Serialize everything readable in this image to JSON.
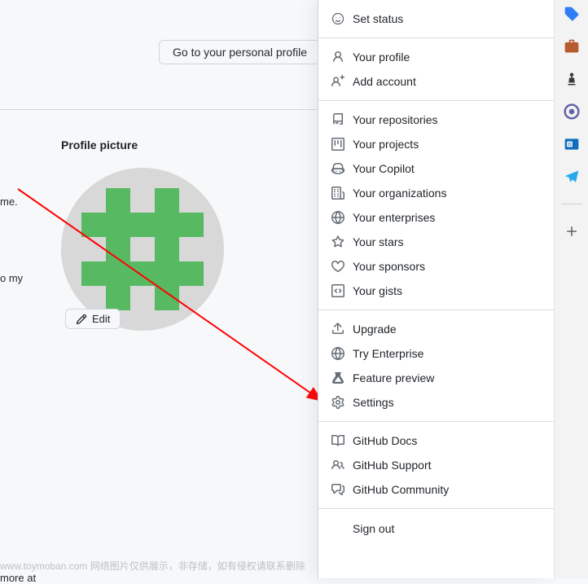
{
  "header": {
    "profile_button": "Go to your personal profile"
  },
  "profile": {
    "title": "Profile picture",
    "edit_label": "Edit"
  },
  "left_text": {
    "me": "me.",
    "o_my": "o my",
    "more_at": "more at"
  },
  "watermark": "www.toymoban.com 网络图片仅供展示，非存储，如有侵权请联系删除",
  "menu": {
    "set_status": "Set status",
    "your_profile": "Your profile",
    "add_account": "Add account",
    "your_repositories": "Your repositories",
    "your_projects": "Your projects",
    "your_copilot": "Your Copilot",
    "your_organizations": "Your organizations",
    "your_enterprises": "Your enterprises",
    "your_stars": "Your stars",
    "your_sponsors": "Your sponsors",
    "your_gists": "Your gists",
    "upgrade": "Upgrade",
    "try_enterprise": "Try Enterprise",
    "feature_preview": "Feature preview",
    "settings": "Settings",
    "github_docs": "GitHub Docs",
    "github_support": "GitHub Support",
    "github_community": "GitHub Community",
    "sign_out": "Sign out"
  },
  "sidebar_icons": {
    "tag": "tag-icon",
    "briefcase": "briefcase-icon",
    "chess": "chess-icon",
    "office": "office-icon",
    "outlook": "outlook-icon",
    "telegram": "telegram-icon",
    "plus": "plus-icon"
  }
}
